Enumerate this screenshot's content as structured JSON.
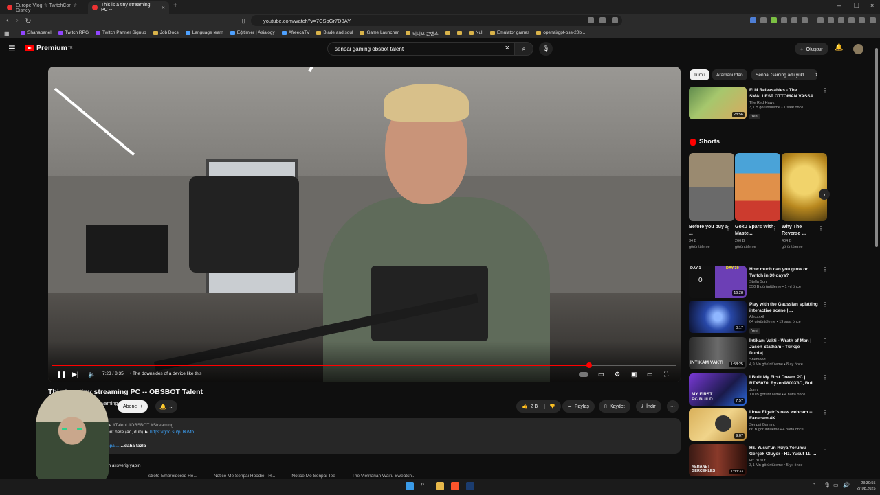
{
  "browser": {
    "tabs": [
      {
        "title": "Europe Vlog ☆ TwitchCon ☆ Disney"
      },
      {
        "title": "This is a tiny streaming PC --"
      }
    ],
    "url": "youtube.com/watch?v=7CSbGr7D3AY",
    "bookmarks": [
      "Shanapanel",
      "Twitch RPG",
      "Twitch Partner Signup",
      "Job Docs",
      "Language learn",
      "Eğitimler | Asialogy",
      "AfreecaTV",
      "Blade and soul",
      "Game Launcher",
      "비디오 콘텐츠",
      "Null",
      "Emulator games",
      "openai/gpt-oss-20b..."
    ]
  },
  "youtube": {
    "logo_text": "Premium",
    "logo_region": "TR",
    "search_value": "senpai gaming obsbot talent",
    "create_label": "Oluştur"
  },
  "player": {
    "time": "7:23 / 8:35",
    "chapter": "• The downsides of a device like this",
    "progress": 0.86,
    "title": "This is a tiny streaming PC -- OBSBOT Talent"
  },
  "meta": {
    "channel": "Senpai Gaming",
    "subscribe_label": "Abone",
    "likes": "2 B",
    "share_label": "Paylaş",
    "save_label": "Kaydet",
    "download_label": "İndir",
    "desc_time": "önce",
    "desc_tags": "#Talent #OBSBOT #Streaming",
    "desc_line2_text": "Talent here (ad, duh) ►",
    "desc_link": "https://goo.su/pUKiMb",
    "desc_line3_tag": "Senpai...",
    "desc_more": "...daha fazla",
    "shop_label": "asından alışveriş yapın",
    "strip_items": [
      "stroto Embroidered He...",
      "Notice Me Senpai Hoodie - H...",
      "Notice Me Senpai Tee",
      "The Vietnarian Waifu Sweatsh..."
    ]
  },
  "sidebar": {
    "chips": [
      "Tümü",
      "Aramanızdan",
      "Senpai Gaming adlı yükl..."
    ],
    "top_video": {
      "title": "EU4 Releasables - The SMALLEST OTTOMAN VASSA...",
      "channel": "The Red Hawk",
      "meta": "3,1 B görüntüleme • 1 saat önce",
      "badge": "Yeni",
      "duration": "28:56"
    },
    "shorts_label": "Shorts",
    "shorts": [
      {
        "title": "Before you buy a ...",
        "views": "34 B",
        "unit": "görüntüleme"
      },
      {
        "title": "Goku Spars With Maste...",
        "views": "266 B",
        "unit": "görüntüleme"
      },
      {
        "title": "Why The Reverse ...",
        "views": "404 B",
        "unit": "görüntüleme"
      }
    ],
    "videos": [
      {
        "title": "How much can you grow on Twitch in 30 days?",
        "channel": "Stella Sun",
        "meta": "350 B görüntüleme • 1 yıl önce",
        "duration": "16:28",
        "badge": ""
      },
      {
        "title": "Play with the Gaussian splatting interactive scene | ...",
        "channel": "Alexxxxil",
        "meta": "64 görüntüleme • 19 saat önce",
        "duration": "0:17",
        "badge": "Yeni"
      },
      {
        "title": "İntikam Vakti - Wrath of Man | Jason Statham - Türkçe Dublaj...",
        "channel": "Shemood",
        "meta": "4,9 Mn görüntüleme • 8 ay önce",
        "duration": "1:58:25",
        "badge": ""
      },
      {
        "title": "I Built My First Dream PC | RTX5070, Ryzen9800X3D, Buil...",
        "channel": "Jumy",
        "meta": "110 B görüntüleme • 4 hafta önce",
        "duration": "7:57",
        "badge": ""
      },
      {
        "title": "I love Elgato's new webcam -- Facecam 4K",
        "channel": "Senpai Gaming",
        "meta": "66 B görüntüleme • 4 hafta önce",
        "duration": "9:07",
        "badge": ""
      },
      {
        "title": "Hz. Yusuf'un Rüya Yorumu Gerçek Oluyor - Hz. Yusuf 11. ...",
        "channel": "Hz. Yusuf",
        "meta": "3,1 Mn görüntüleme • 5 yıl önce",
        "duration": "1:33:33",
        "badge": ""
      }
    ]
  },
  "thumbs_text": {
    "v1_top": "DAY 1",
    "v1_top2": "DAY 30",
    "v1_count": "0",
    "v3_text": "İNTİKAM VAKTİ",
    "v4_text": "MY FIRST PC BUILD",
    "v6_text": "KEHANET GERÇEKLEŞ"
  },
  "taskbar": {
    "time": "23:30:55",
    "date": "27.08.2025"
  },
  "colors": {
    "accent": "#ff0000",
    "link": "#3ea6ff",
    "bg": "#0f0f0f"
  }
}
